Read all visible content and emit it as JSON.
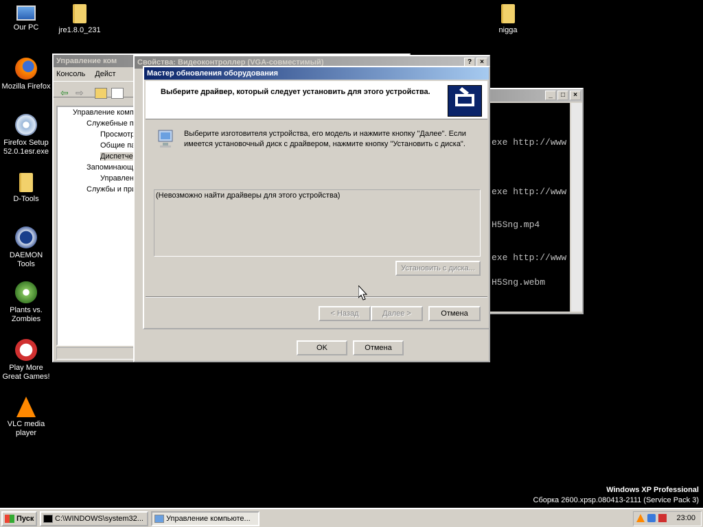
{
  "desktop": {
    "icons": [
      {
        "label": "Our PC"
      },
      {
        "label": "jre1.8.0_231"
      },
      {
        "label": "nigga"
      },
      {
        "label": "Mozilla Firefox"
      },
      {
        "label": "Firefox Setup 52.0.1esr.exe"
      },
      {
        "label": "D-Tools"
      },
      {
        "label": "DAEMON Tools"
      },
      {
        "label": "Plants vs. Zombies"
      },
      {
        "label": "Play More Great Games!"
      },
      {
        "label": "VLC media player"
      }
    ],
    "watermark": {
      "line1": "Windows XP Professional",
      "line2": "Сборка 2600.xpsp.080413-2111 (Service Pack 3)"
    }
  },
  "console": {
    "lines": [
      "exe http://www",
      "exe http://www",
      "H5Sng.mp4",
      "exe http://www",
      "H5Sng.webm"
    ]
  },
  "compmgmt": {
    "title": "Управление ком",
    "menu": [
      "Консоль",
      "Дейст"
    ],
    "tree": [
      "Управление комп",
      "Служебные п",
      "Просмотр",
      "Общие па",
      "Диспетче",
      "Запоминающ",
      "Управлен",
      "Службы и при"
    ]
  },
  "props": {
    "title": "Свойства: Видеоконтроллер (VGA-совместимый)",
    "ok": "OK",
    "cancel": "Отмена"
  },
  "wizard": {
    "title": "Мастер обновления оборудования",
    "header": "Выберите драйвер, который следует установить для этого устройства.",
    "description": "Выберите изготовителя устройства, его модель и нажмите кнопку \"Далее\". Если имеется установочный диск с  драйвером, нажмите кнопку \"Установить с диска\".",
    "list_text": "(Невозможно найти драйверы для этого устройства)",
    "have_disk": "Установить с диска...",
    "back": "< Назад",
    "next": "Далее >",
    "cancel": "Отмена"
  },
  "taskbar": {
    "start": "Пуск",
    "tasks": [
      "C:\\WINDOWS\\system32...",
      "Управление компьюте..."
    ],
    "clock": "23:00"
  }
}
